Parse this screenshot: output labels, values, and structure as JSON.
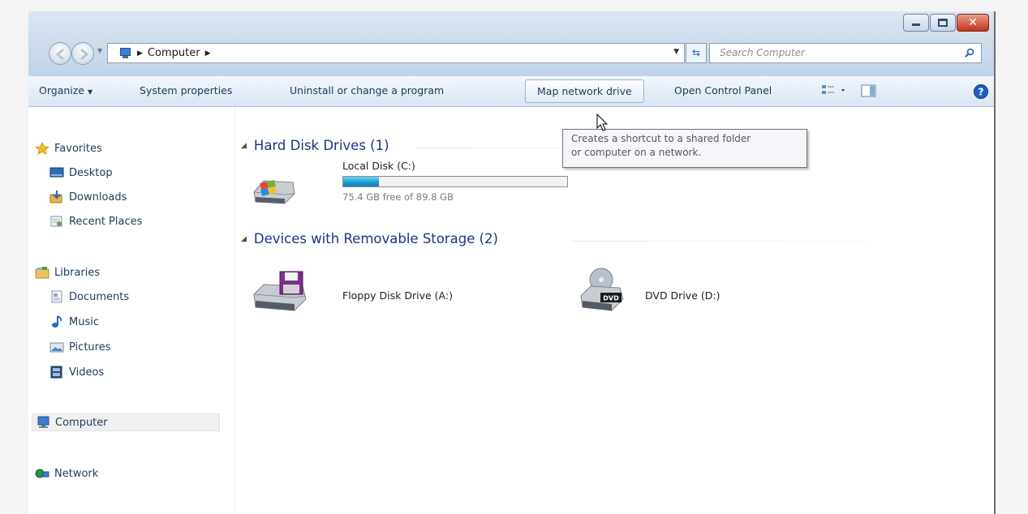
{
  "window": {
    "controls": {
      "minimize": "minimize",
      "restore": "restore",
      "close": "close"
    }
  },
  "address": {
    "path": [
      "Computer"
    ],
    "search_placeholder": "Search Computer"
  },
  "toolbar": {
    "organize": "Organize",
    "system_properties": "System properties",
    "uninstall": "Uninstall or change a program",
    "map_network_drive": "Map network drive",
    "open_control_panel": "Open Control Panel"
  },
  "tooltip": {
    "line1": "Creates a shortcut to a shared folder",
    "line2": "or computer on a network."
  },
  "sidebar": {
    "favorites": "Favorites",
    "desktop": "Desktop",
    "downloads": "Downloads",
    "recent_places": "Recent Places",
    "libraries": "Libraries",
    "documents": "Documents",
    "music": "Music",
    "pictures": "Pictures",
    "videos": "Videos",
    "computer": "Computer",
    "network": "Network"
  },
  "groups": {
    "hard_disk": {
      "title": "Hard Disk Drives (1)",
      "drives": [
        {
          "label": "Local Disk (C:)",
          "free_text": "75.4 GB free of 89.8 GB",
          "used_fraction": 0.16
        }
      ]
    },
    "removable": {
      "title": "Devices with Removable Storage (2)",
      "drives": [
        {
          "label": "Floppy Disk Drive (A:)"
        },
        {
          "label": "DVD Drive (D:)",
          "badge": "DVD"
        }
      ]
    }
  },
  "colors": {
    "accent": "#1e3287",
    "toolbar_text": "#1e395b",
    "capacity_fill": "#1c98cf"
  }
}
